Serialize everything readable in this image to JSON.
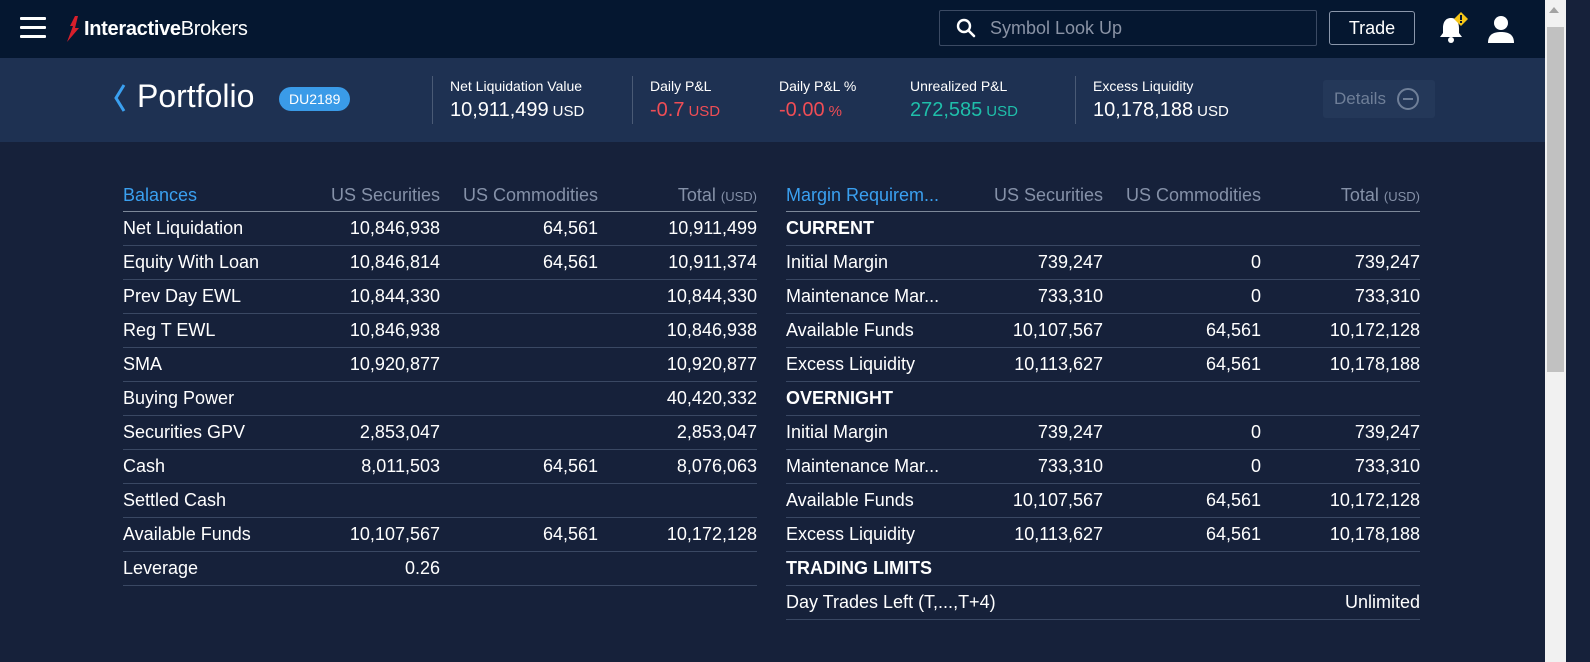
{
  "header": {
    "brand_bold": "Interactive",
    "brand_rest": "Brokers",
    "search_placeholder": "Symbol Look Up",
    "trade_label": "Trade",
    "alert_icon": "bell-warning-icon"
  },
  "summary": {
    "title": "Portfolio",
    "account": "DU2189",
    "metrics": [
      {
        "label": "Net Liquidation Value",
        "value": "10,911,499",
        "unit": "USD"
      },
      {
        "label": "Daily P&L",
        "value": "-0.7",
        "unit": "USD"
      },
      {
        "label": "Daily P&L %",
        "value": "-0.00",
        "unit": "%"
      },
      {
        "label": "Unrealized P&L",
        "value": "272,585",
        "unit": "USD"
      },
      {
        "label": "Excess Liquidity",
        "value": "10,178,188",
        "unit": "USD"
      }
    ],
    "details_label": "Details"
  },
  "colors": {
    "negative": "#ef4d55",
    "positive": "#1fbfaa",
    "accent": "#3aa0f0"
  },
  "balances": {
    "headers": [
      "Balances",
      "US Securities",
      "US Commodities",
      "Total",
      "(USD)"
    ],
    "rows": [
      [
        "Net Liquidation",
        "10,846,938",
        "64,561",
        "10,911,499"
      ],
      [
        "Equity With Loan",
        "10,846,814",
        "64,561",
        "10,911,374"
      ],
      [
        "Prev Day EWL",
        "10,844,330",
        "",
        "10,844,330"
      ],
      [
        "Reg T EWL",
        "10,846,938",
        "",
        "10,846,938"
      ],
      [
        "SMA",
        "10,920,877",
        "",
        "10,920,877"
      ],
      [
        "Buying Power",
        "",
        "",
        "40,420,332"
      ],
      [
        "Securities GPV",
        "2,853,047",
        "",
        "2,853,047"
      ],
      [
        "Cash",
        "8,011,503",
        "64,561",
        "8,076,063"
      ],
      [
        "Settled Cash",
        "",
        "",
        ""
      ],
      [
        "Available Funds",
        "10,107,567",
        "64,561",
        "10,172,128"
      ],
      [
        "Leverage",
        "0.26",
        "",
        ""
      ]
    ]
  },
  "margin": {
    "headers": [
      "Margin Requirem...",
      "US Securities",
      "US Commodities",
      "Total",
      "(USD)"
    ],
    "sections": [
      {
        "title": "CURRENT",
        "rows": [
          [
            "Initial Margin",
            "739,247",
            "0",
            "739,247"
          ],
          [
            "Maintenance Mar...",
            "733,310",
            "0",
            "733,310"
          ],
          [
            "Available Funds",
            "10,107,567",
            "64,561",
            "10,172,128"
          ],
          [
            "Excess Liquidity",
            "10,113,627",
            "64,561",
            "10,178,188"
          ]
        ]
      },
      {
        "title": "OVERNIGHT",
        "rows": [
          [
            "Initial Margin",
            "739,247",
            "0",
            "739,247"
          ],
          [
            "Maintenance Mar...",
            "733,310",
            "0",
            "733,310"
          ],
          [
            "Available Funds",
            "10,107,567",
            "64,561",
            "10,172,128"
          ],
          [
            "Excess Liquidity",
            "10,113,627",
            "64,561",
            "10,178,188"
          ]
        ]
      },
      {
        "title": "TRADING LIMITS",
        "rows": [
          [
            "Day Trades Left (T,...,T+4)",
            "",
            "",
            "Unlimited"
          ]
        ]
      }
    ]
  }
}
